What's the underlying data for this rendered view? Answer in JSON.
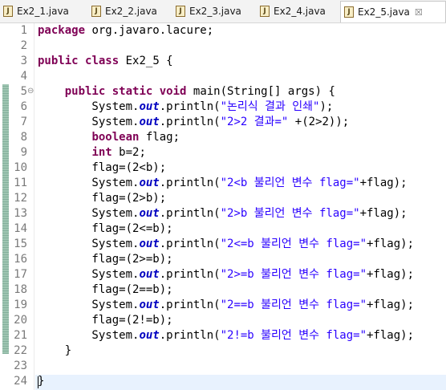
{
  "tabs": [
    {
      "label": "Ex2_1.java",
      "active": false
    },
    {
      "label": "Ex2_2.java",
      "active": false
    },
    {
      "label": "Ex2_3.java",
      "active": false
    },
    {
      "label": "Ex2_4.java",
      "active": false
    },
    {
      "label": "Ex2_5.java",
      "active": true
    }
  ],
  "tab_close_glyph": "☒",
  "icons": {
    "java_file": "java-file-icon",
    "fold": "collapse-fold-icon",
    "close": "close-tab-icon"
  },
  "colors": {
    "keyword": "#7f0055",
    "string": "#2a00ff",
    "field": "#0000c0",
    "line_number": "#7a7a7a"
  },
  "editor": {
    "line_numbers": [
      "1",
      "2",
      "3",
      "4",
      "5",
      "6",
      "7",
      "8",
      "9",
      "10",
      "11",
      "12",
      "13",
      "14",
      "15",
      "16",
      "17",
      "18",
      "19",
      "20",
      "21",
      "22",
      "23",
      "24"
    ],
    "fold_marker": "⊖",
    "lines": [
      "package org.javaro.lacure;",
      "",
      "public class Ex2_5 {",
      "",
      "    public static void main(String[] args) {",
      "        System.out.println(\"논리식 결과 인쇄\");",
      "        System.out.println(\"2>2 결과=\" +(2>2));",
      "        boolean flag;",
      "        int b=2;",
      "        flag=(2<b);",
      "        System.out.println(\"2<b 불리언 변수 flag=\"+flag);",
      "        flag=(2>b);",
      "        System.out.println(\"2>b 불리언 변수 flag=\"+flag);",
      "        flag=(2<=b);",
      "        System.out.println(\"2<=b 불리언 변수 flag=\"+flag);",
      "        flag=(2>=b);",
      "        System.out.println(\"2>=b 불리언 변수 flag=\"+flag);",
      "        flag=(2==b);",
      "        System.out.println(\"2==b 불리언 변수 flag=\"+flag);",
      "        flag=(2!=b);",
      "        System.out.println(\"2!=b 불리언 변수 flag=\"+flag);",
      "    }",
      "",
      "}"
    ]
  }
}
